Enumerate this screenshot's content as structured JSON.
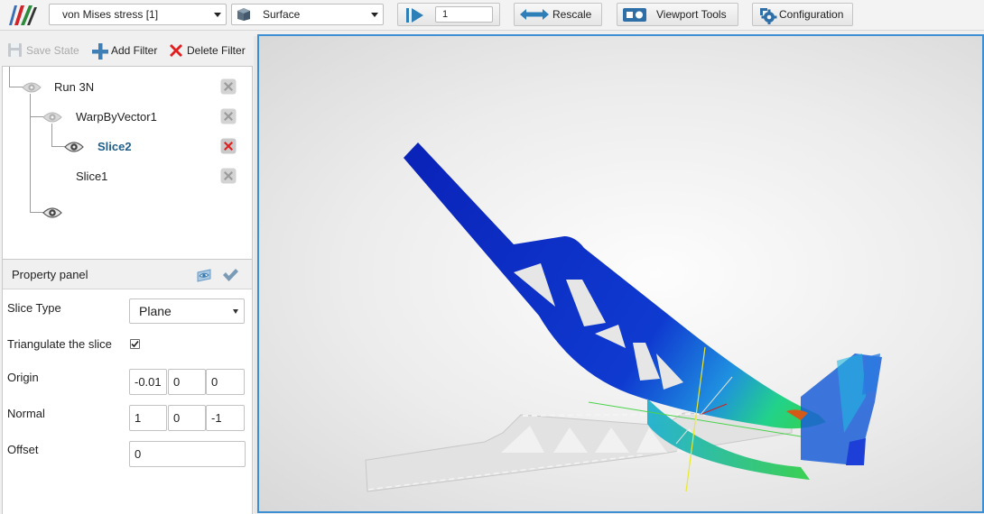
{
  "toolbar": {
    "field_select": "von Mises stress [1]",
    "representation_select": "Surface",
    "time_step": "1",
    "rescale_label": "Rescale",
    "viewport_tools_label": "Viewport Tools",
    "configuration_label": "Configuration"
  },
  "pipeline": {
    "save_state_label": "Save State",
    "add_filter_label": "Add Filter",
    "delete_filter_label": "Delete Filter",
    "nodes": [
      {
        "label": "Run 3N"
      },
      {
        "label": "WarpByVector1"
      },
      {
        "label": "Slice2"
      },
      {
        "label": "Slice1"
      }
    ]
  },
  "property_panel": {
    "title": "Property panel",
    "slice_type": {
      "label": "Slice Type",
      "value": "Plane"
    },
    "triangulate": {
      "label": "Triangulate the slice",
      "checked": true
    },
    "origin": {
      "label": "Origin",
      "values": [
        "-0.01",
        "0",
        "0"
      ]
    },
    "normal": {
      "label": "Normal",
      "values": [
        "1",
        "0",
        "-1"
      ]
    },
    "offset": {
      "label": "Offset",
      "value": "0"
    }
  },
  "colors": {
    "accent": "#3d8fd4",
    "stress_low": "#0a28c0",
    "stress_mid": "#1ed26a",
    "stress_high": "#d45a18",
    "undeformed_part": "#e2e2e2"
  }
}
